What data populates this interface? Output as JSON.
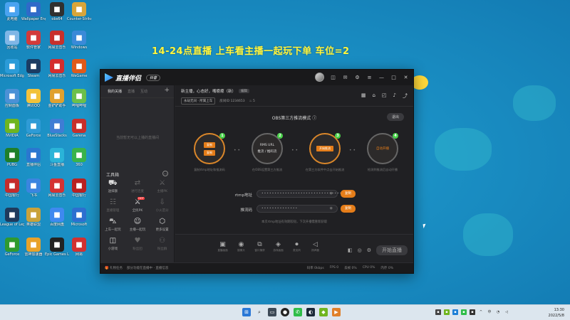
{
  "desktop": {
    "banner": "14-24点直播   上车看主播一起玩下单 车位=2",
    "icons": [
      {
        "label": "此电脑",
        "icon": "monitor-icon",
        "color": "#4aa3f0"
      },
      {
        "label": "Wallpaper Engine",
        "icon": "wallpaper-icon",
        "color": "#2f6ac9"
      },
      {
        "label": "obs64",
        "icon": "obs-icon",
        "color": "#303030"
      },
      {
        "label": "Counter-Strike",
        "icon": "cs-icon",
        "color": "#d8a53a"
      },
      {
        "label": "回收站",
        "icon": "recycle-bin-icon",
        "color": "#7fb6e6"
      },
      {
        "label": "软件管家",
        "icon": "app-icon",
        "color": "#d23a3a"
      },
      {
        "label": "网易云音乐",
        "icon": "music-icon",
        "color": "#c8302b"
      },
      {
        "label": "Windows",
        "icon": "windows-icon",
        "color": "#3a8ad8"
      },
      {
        "label": "Microsoft Edge",
        "icon": "edge-icon",
        "color": "#2b9bd8"
      },
      {
        "label": "Steam",
        "icon": "steam-icon",
        "color": "#1b3c63"
      },
      {
        "label": "网易云音乐",
        "icon": "music-icon",
        "color": "#d42d2d"
      },
      {
        "label": "WeGame",
        "icon": "wegame-icon",
        "color": "#e05a1a"
      },
      {
        "label": "控制面板",
        "icon": "control-panel-icon",
        "color": "#4b91d6"
      },
      {
        "label": "腾讯QQ",
        "icon": "qq-icon",
        "color": "#f2c23a"
      },
      {
        "label": "金铲铲助手",
        "icon": "game-icon",
        "color": "#e0a12f"
      },
      {
        "label": "哔哩哔哩",
        "icon": "app-icon",
        "color": "#6cc04a"
      },
      {
        "label": "NVIDIA",
        "icon": "nvidia-icon",
        "color": "#6fb51f"
      },
      {
        "label": "GeForce",
        "icon": "geforce-icon",
        "color": "#2f9bd6"
      },
      {
        "label": "BlueStacks",
        "icon": "app-icon",
        "color": "#3f7dd4"
      },
      {
        "label": "Garena",
        "icon": "app-icon",
        "color": "#c7302c"
      },
      {
        "label": "PUBG",
        "icon": "app-icon",
        "color": "#1f7f2a"
      },
      {
        "label": "直播伴侣",
        "icon": "app-icon",
        "color": "#2a77d0"
      },
      {
        "label": "斗鱼直播",
        "icon": "app-icon",
        "color": "#2ab4d8"
      },
      {
        "label": "360",
        "icon": "app-icon",
        "color": "#3ab34a"
      },
      {
        "label": "中国银行",
        "icon": "bank-icon",
        "color": "#c52c2c"
      },
      {
        "label": "飞书",
        "icon": "app-icon",
        "color": "#3b85e0"
      },
      {
        "label": "网易云音乐",
        "icon": "music-icon",
        "color": "#d43232"
      },
      {
        "label": "中国银行",
        "icon": "bank-icon",
        "color": "#b82121"
      },
      {
        "label": "League of Legends",
        "icon": "lol-icon",
        "color": "#1f3a5c"
      },
      {
        "label": "英雄联盟",
        "icon": "game-icon",
        "color": "#c9a23a"
      },
      {
        "label": "百度网盘",
        "icon": "cloud-icon",
        "color": "#3f89f0"
      },
      {
        "label": "Microsoft",
        "icon": "app-icon",
        "color": "#2d6fd0"
      },
      {
        "label": "GeForce",
        "icon": "app-icon",
        "color": "#2f9a2f"
      },
      {
        "label": "雷神加速器",
        "icon": "app-icon",
        "color": "#e8a22a"
      },
      {
        "label": "Epic Games Launcher",
        "icon": "epic-icon",
        "color": "#222222"
      },
      {
        "label": "网易",
        "icon": "app-icon",
        "color": "#d23131"
      }
    ]
  },
  "app": {
    "name": "直播伴侣",
    "version": "抖音",
    "left_tabs": [
      "我的关播",
      "直播",
      "互动"
    ],
    "left_empty": "当前暂无可以上播的直播间",
    "tools_title": "工具箱",
    "tools": [
      {
        "label": "送抹额",
        "icon": "gift-icon",
        "dim": false
      },
      {
        "label": "进行连麦",
        "icon": "link-icon",
        "dim": true
      },
      {
        "label": "主播PK",
        "icon": "pk-icon",
        "dim": true
      },
      {
        "label": "直播管理",
        "icon": "manage-icon",
        "dim": true
      },
      {
        "label": "全民PK",
        "icon": "pk-icon",
        "dim": false,
        "hot": "HOT"
      },
      {
        "label": "小火苗分",
        "icon": "download-icon",
        "dim": true
      },
      {
        "label": "上车一起玩",
        "icon": "car-icon",
        "dim": false
      },
      {
        "label": "主播一起玩",
        "icon": "people-icon",
        "dim": false
      },
      {
        "label": "更多设置",
        "icon": "box-icon",
        "dim": false
      },
      {
        "label": "小游戏",
        "icon": "gamepad-icon",
        "dim": false
      },
      {
        "label": "粉丝团",
        "icon": "fans-icon",
        "dim": true
      },
      {
        "label": "粉丝群",
        "icon": "group-icon",
        "dim": true
      }
    ],
    "stream": {
      "title": "新主播，心态好，嘴瘪瘪（新）",
      "edit_label": "编辑",
      "category": "永劫无间 · 所属上车",
      "account": "房间ID 1234653",
      "fans": "5"
    },
    "obs": {
      "title": "OBS第三方推流模式",
      "exit": "退出",
      "steps": [
        {
          "num": "1",
          "buttons": [
            "复制",
            "复制"
          ],
          "desc": "复制rtmp地址和推流码"
        },
        {
          "num": "2",
          "lines": [
            "RMS URL",
            "推流 / 推码流"
          ],
          "desc": "在OBS设置第三方推流",
          "plain": true
        },
        {
          "num": "3",
          "buttons": [
            "开始推流"
          ],
          "desc": "在第三方软件中点击开始推流"
        },
        {
          "num": "4",
          "lines": [
            "自动开播"
          ],
          "desc": "检测到推流后自动开播",
          "plain": true
        }
      ],
      "rtmp_label": "rtmp地址",
      "rtmp_value": "••••••••••••••••••••••••••••••••",
      "key_label": "推流码",
      "key_value": "••••••••••••••",
      "copy_label": "复制",
      "hint": "本次rtmp地址有效期较短，下次开播需重新获取"
    },
    "bottom_tools": [
      {
        "label": "直播画面",
        "icon": "screen-icon"
      },
      {
        "label": "摄像头",
        "icon": "camera-icon"
      },
      {
        "label": "窗口捕获",
        "icon": "window-icon"
      },
      {
        "label": "游戏画面",
        "icon": "game-icon"
      },
      {
        "label": "麦克风",
        "icon": "mic-icon"
      },
      {
        "label": "扬声器",
        "icon": "speaker-icon"
      }
    ],
    "start_label": "开始直播",
    "status_left": "礼物任务",
    "status_msg": "部分功能在直播中 · 直播信息",
    "status_stats": [
      "码率 0kbps",
      "FPS 0",
      "丢帧 0%",
      "CPU 0%",
      "内存 0%"
    ]
  },
  "taskbar": {
    "time": "13:30",
    "date": "2022/5/8"
  }
}
